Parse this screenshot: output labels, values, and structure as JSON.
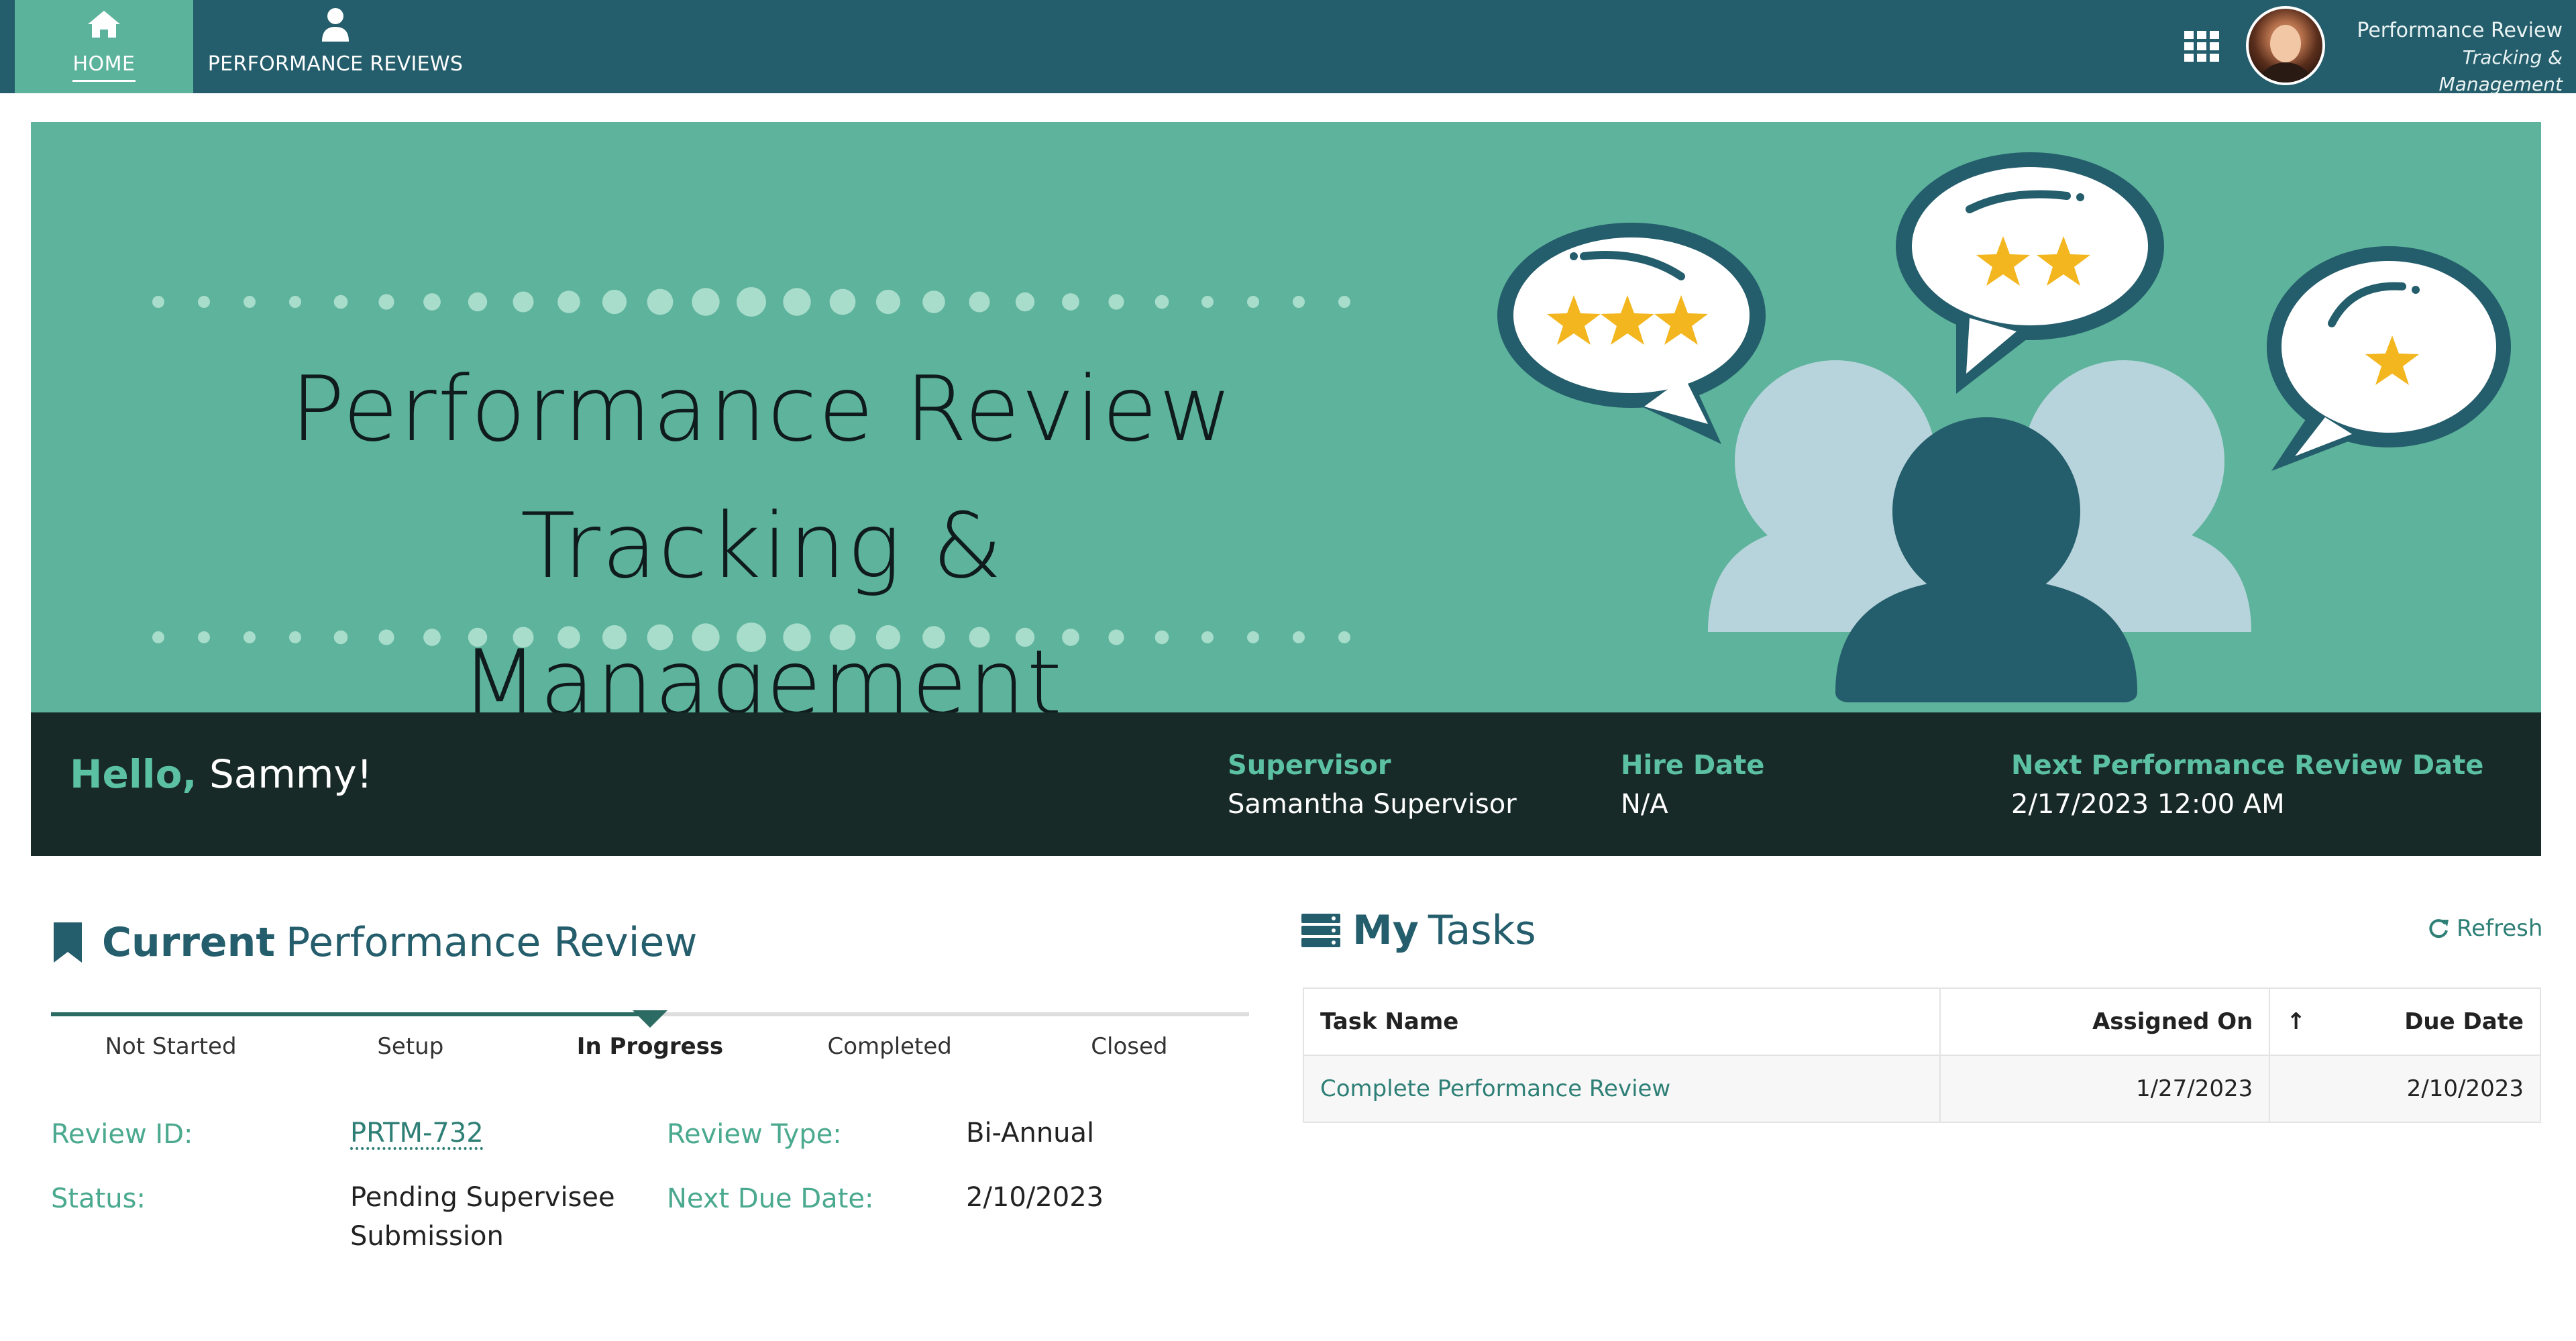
{
  "nav": {
    "home_label": "HOME",
    "reviews_label": "PERFORMANCE REVIEWS",
    "brand_line1": "Performance Review",
    "brand_line2": "Tracking & Management"
  },
  "hero": {
    "title_line1": "Performance Review Tracking &",
    "title_line2": "Management"
  },
  "welcome": {
    "hello": "Hello,",
    "name": "Sammy!",
    "supervisor_label": "Supervisor",
    "supervisor_value": "Samantha Supervisor",
    "hire_label": "Hire Date",
    "hire_value": "N/A",
    "next_label": "Next Performance Review Date",
    "next_value": "2/17/2023 12:00 AM"
  },
  "current_review": {
    "title_bold": "Current",
    "title_rest": "Performance Review",
    "stages": [
      "Not Started",
      "Setup",
      "In Progress",
      "Completed",
      "Closed"
    ],
    "active_stage": 2,
    "review_id_label": "Review ID:",
    "review_id_value": "PRTM-732",
    "review_type_label": "Review Type:",
    "review_type_value": "Bi-Annual",
    "status_label": "Status:",
    "status_value_line1": "Pending Supervisee",
    "status_value_line2": "Submission",
    "next_due_label": "Next Due Date:",
    "next_due_value": "2/10/2023"
  },
  "tasks": {
    "title_bold": "My",
    "title_rest": "Tasks",
    "refresh_label": "Refresh",
    "columns": [
      "Task Name",
      "Assigned On",
      "↑",
      "Due Date"
    ],
    "rows": [
      {
        "name": "Complete Performance Review",
        "assigned": "1/27/2023",
        "due": "2/10/2023"
      }
    ]
  },
  "colors": {
    "nav": "#245d6b",
    "nav_active": "#5bb39b",
    "hero": "#5db39b",
    "welcome_bar": "#182a27",
    "accent": "#5bc1a2",
    "star": "#f3b61f"
  }
}
